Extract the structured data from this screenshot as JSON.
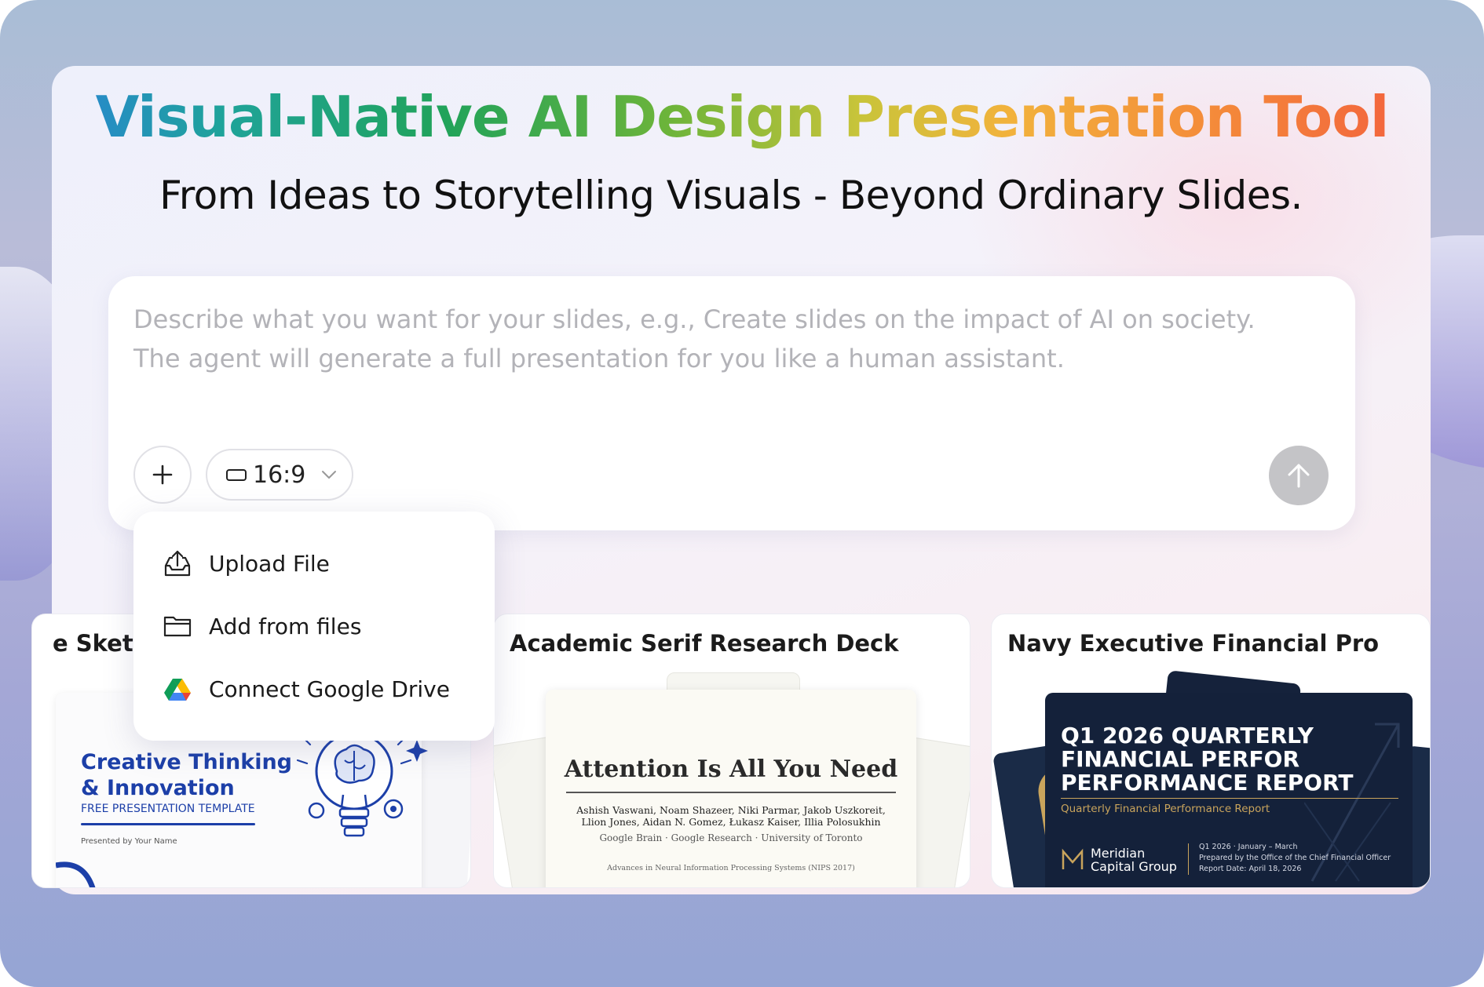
{
  "hero": {
    "title": "Visual-Native AI Design Presentation Tool",
    "subtitle": "From Ideas to Storytelling Visuals - Beyond Ordinary Slides."
  },
  "prompt": {
    "placeholder_line1": "Describe what you want for your slides, e.g., Create slides on the impact of AI on society.",
    "placeholder_line2": "The agent will generate a full presentation for you like a human assistant.",
    "plus_label": "+",
    "ratio_label": "16:9"
  },
  "menu": {
    "items": [
      {
        "label": "Upload File",
        "icon": "upload-icon"
      },
      {
        "label": "Add from files",
        "icon": "folder-icon"
      },
      {
        "label": "Connect Google Drive",
        "icon": "google-drive-icon"
      }
    ]
  },
  "templates": [
    {
      "title": "e Sketc",
      "slide": {
        "heading_line1": "Creative Thinking",
        "heading_line2": "& Innovation",
        "subheading": "FREE PRESENTATION TEMPLATE",
        "presenter": "Presented by Your Name"
      }
    },
    {
      "title": "Academic Serif Research Deck",
      "slide": {
        "heading": "Attention Is All You Need",
        "authors_line1": "Ashish Vaswani, Noam Shazeer, Niki Parmar, Jakob Uszkoreit,",
        "authors_line2": "Llion Jones, Aidan N. Gomez, Łukasz Kaiser, Illia Polosukhin",
        "affiliations": "Google Brain · Google Research · University of Toronto",
        "venue": "Advances in Neural Information Processing Systems (NIPS 2017)"
      }
    },
    {
      "title": "Navy Executive Financial Pro",
      "slide": {
        "heading_line1": "Q1 2026 QUARTERLY",
        "heading_line2": "FINANCIAL PERFOR",
        "heading_line3": "PERFORMANCE REPORT",
        "subheading": "Quarterly Financial Performance Report",
        "brand_line1": "Meridian",
        "brand_line2": "Capital Group",
        "meta_line1": "Q1 2026 · January – March",
        "meta_line2": "Prepared by the Office of the Chief Financial Officer",
        "meta_line3": "Report Date: April 18, 2026"
      }
    }
  ],
  "colors": {
    "accent_blue": "#2b7be6",
    "gold": "#c9a45c",
    "navy": "#14213a",
    "send_disabled": "#c4c4c7"
  }
}
